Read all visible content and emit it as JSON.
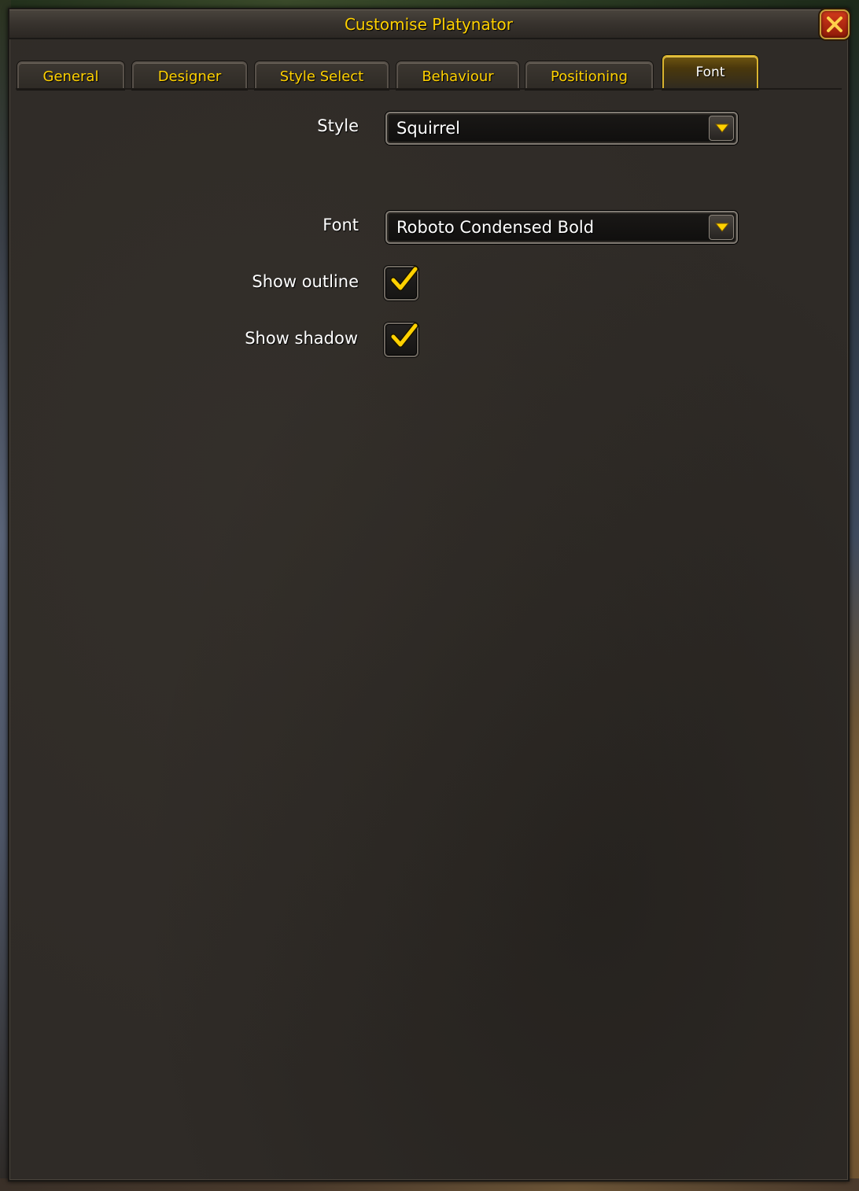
{
  "window": {
    "title": "Customise Platynator"
  },
  "tabs": [
    {
      "label": "General",
      "active": false
    },
    {
      "label": "Designer",
      "active": false
    },
    {
      "label": "Style Select",
      "active": false
    },
    {
      "label": "Behaviour",
      "active": false
    },
    {
      "label": "Positioning",
      "active": false
    },
    {
      "label": "Font",
      "active": true
    }
  ],
  "form": {
    "style": {
      "label": "Style",
      "value": "Squirrel"
    },
    "font": {
      "label": "Font",
      "value": "Roboto Condensed Bold"
    },
    "show_outline": {
      "label": "Show outline",
      "checked": true
    },
    "show_shadow": {
      "label": "Show shadow",
      "checked": true
    }
  },
  "colors": {
    "accent_gold": "#ffd100",
    "panel_bg": "#2f2b27",
    "close_red": "#c8321a"
  },
  "icons": {
    "close": "close-x-icon",
    "dropdown": "dropdown-arrow-icon",
    "check": "checkmark-icon"
  }
}
